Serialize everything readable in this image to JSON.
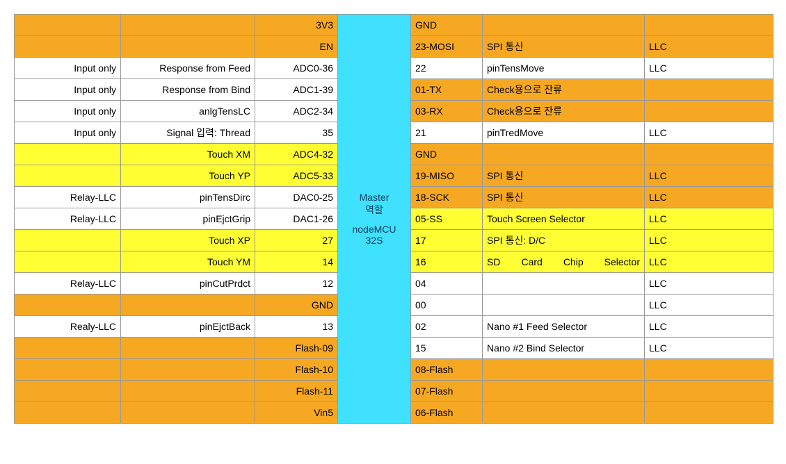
{
  "center": {
    "line1": "Master",
    "line2": "역할",
    "line3": "nodeMCU",
    "line4": "32S"
  },
  "rows": [
    {
      "l": [
        "",
        "",
        "3V3"
      ],
      "lbg": [
        "orange",
        "orange",
        "orange"
      ],
      "r": [
        "GND",
        "",
        ""
      ],
      "rbg": [
        "orange",
        "orange",
        "orange"
      ]
    },
    {
      "l": [
        "",
        "",
        "EN"
      ],
      "lbg": [
        "orange",
        "orange",
        "orange"
      ],
      "r": [
        "23-MOSI",
        "SPI 통신",
        "LLC"
      ],
      "rbg": [
        "orange",
        "orange",
        "orange"
      ]
    },
    {
      "l": [
        "Input only",
        "Response from Feed",
        "ADC0-36"
      ],
      "lbg": [
        "white",
        "white",
        "white"
      ],
      "r": [
        "22",
        "pinTensMove",
        "LLC"
      ],
      "rbg": [
        "white",
        "white",
        "white"
      ]
    },
    {
      "l": [
        "Input only",
        "Response from Bind",
        "ADC1-39"
      ],
      "lbg": [
        "white",
        "white",
        "white"
      ],
      "r": [
        "01-TX",
        "Check용으로 잔류",
        ""
      ],
      "rbg": [
        "orange",
        "orange",
        "orange"
      ]
    },
    {
      "l": [
        "Input only",
        "anlgTensLC",
        "ADC2-34"
      ],
      "lbg": [
        "white",
        "white",
        "white"
      ],
      "r": [
        "03-RX",
        "Check용으로 잔류",
        ""
      ],
      "rbg": [
        "orange",
        "orange",
        "orange"
      ]
    },
    {
      "l": [
        "Input only",
        "Signal 입력: Thread",
        "35"
      ],
      "lbg": [
        "white",
        "white",
        "white"
      ],
      "r": [
        "21",
        "pinTredMove",
        "LLC"
      ],
      "rbg": [
        "white",
        "white",
        "white"
      ]
    },
    {
      "l": [
        "",
        "Touch  XM",
        "ADC4-32"
      ],
      "lbg": [
        "yellow",
        "yellow",
        "yellow"
      ],
      "r": [
        "GND",
        "",
        ""
      ],
      "rbg": [
        "orange",
        "orange",
        "orange"
      ]
    },
    {
      "l": [
        "",
        "Touch  YP",
        "ADC5-33"
      ],
      "lbg": [
        "yellow",
        "yellow",
        "yellow"
      ],
      "r": [
        "19-MISO",
        "SPI 통신",
        "LLC"
      ],
      "rbg": [
        "orange",
        "orange",
        "orange"
      ]
    },
    {
      "l": [
        "Relay-LLC",
        "pinTensDirc",
        "DAC0-25"
      ],
      "lbg": [
        "white",
        "white",
        "white"
      ],
      "r": [
        "18-SCK",
        "SPI 통신",
        "LLC"
      ],
      "rbg": [
        "orange",
        "orange",
        "orange"
      ]
    },
    {
      "l": [
        "Relay-LLC",
        "pinEjctGrip",
        "DAC1-26"
      ],
      "lbg": [
        "white",
        "white",
        "white"
      ],
      "r": [
        "05-SS",
        "Touch Screen Selector",
        "LLC"
      ],
      "rbg": [
        "yellow",
        "yellow",
        "yellow"
      ]
    },
    {
      "l": [
        "",
        "Touch  XP",
        "27"
      ],
      "lbg": [
        "yellow",
        "yellow",
        "yellow"
      ],
      "r": [
        "17",
        "SPI 통신: D/C",
        "LLC"
      ],
      "rbg": [
        "yellow",
        "yellow",
        "yellow"
      ]
    },
    {
      "l": [
        "",
        "Touch  YM",
        "14"
      ],
      "lbg": [
        "yellow",
        "yellow",
        "yellow"
      ],
      "r": [
        "16",
        "SD Card Chip Selector",
        "LLC"
      ],
      "rbg": [
        "yellow",
        "yellow",
        "yellow"
      ],
      "rejustify": true
    },
    {
      "l": [
        "Relay-LLC",
        "pinCutPrdct",
        "12"
      ],
      "lbg": [
        "white",
        "white",
        "white"
      ],
      "r": [
        "04",
        "",
        "LLC"
      ],
      "rbg": [
        "white",
        "white",
        "white"
      ]
    },
    {
      "l": [
        "",
        "",
        "GND"
      ],
      "lbg": [
        "orange",
        "orange",
        "orange"
      ],
      "r": [
        "00",
        "",
        "LLC"
      ],
      "rbg": [
        "white",
        "white",
        "white"
      ]
    },
    {
      "l": [
        "Realy-LLC",
        "pinEjctBack",
        "13"
      ],
      "lbg": [
        "white",
        "white",
        "white"
      ],
      "r": [
        "02",
        "Nano #1 Feed Selector",
        "LLC"
      ],
      "rbg": [
        "white",
        "white",
        "white"
      ]
    },
    {
      "l": [
        "",
        "",
        "Flash-09"
      ],
      "lbg": [
        "orange",
        "orange",
        "orange"
      ],
      "r": [
        "15",
        "Nano #2 Bind Selector",
        "LLC"
      ],
      "rbg": [
        "white",
        "white",
        "white"
      ]
    },
    {
      "l": [
        "",
        "",
        "Flash-10"
      ],
      "lbg": [
        "orange",
        "orange",
        "orange"
      ],
      "r": [
        "08-Flash",
        "",
        ""
      ],
      "rbg": [
        "orange",
        "orange",
        "orange"
      ]
    },
    {
      "l": [
        "",
        "",
        "Flash-11"
      ],
      "lbg": [
        "orange",
        "orange",
        "orange"
      ],
      "r": [
        "07-Flash",
        "",
        ""
      ],
      "rbg": [
        "orange",
        "orange",
        "orange"
      ]
    },
    {
      "l": [
        "",
        "",
        "Vin5"
      ],
      "lbg": [
        "orange",
        "orange",
        "orange"
      ],
      "r": [
        "06-Flash",
        "",
        ""
      ],
      "rbg": [
        "orange",
        "orange",
        "orange"
      ]
    }
  ]
}
